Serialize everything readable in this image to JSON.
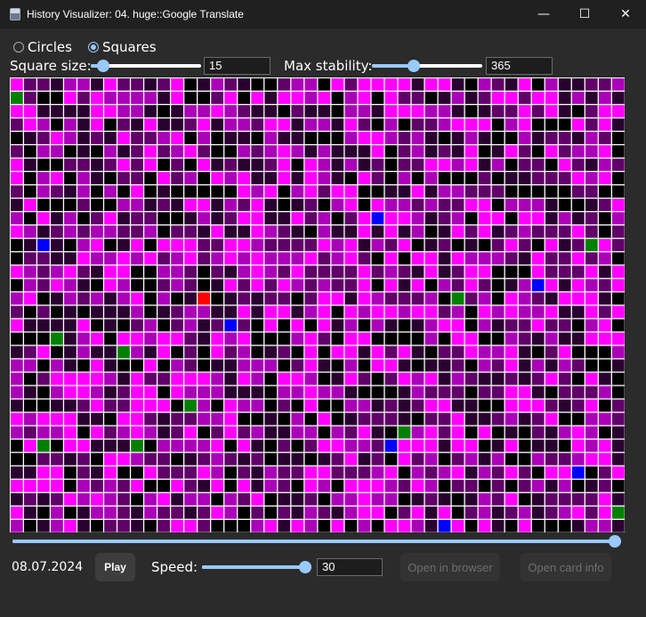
{
  "window": {
    "title": "History Visualizer: 04. huge::Google Translate",
    "minimize_glyph": "—",
    "maximize_glyph": "☐",
    "close_glyph": "✕"
  },
  "shape": {
    "options": [
      {
        "label": "Circles",
        "checked": false
      },
      {
        "label": "Squares",
        "checked": true
      }
    ]
  },
  "square_size": {
    "label": "Square size:",
    "value": "15",
    "fraction": 0.06
  },
  "max_stability": {
    "label": "Max stability:",
    "value": "365",
    "fraction": 0.36
  },
  "timeline": {
    "fraction": 1.0
  },
  "date": "08.07.2024",
  "play_label": "Play",
  "speed": {
    "label": "Speed:",
    "value": "30",
    "fraction": 1.0
  },
  "open_browser_label": "Open in browser",
  "open_card_label": "Open card info",
  "grid": {
    "cols": 46,
    "rows": 34,
    "palette": [
      "#000000",
      "#2a0030",
      "#600068",
      "#aa00b8",
      "#ff00ff"
    ],
    "special_colors": {
      "green": "#008000",
      "blue": "#0000ff",
      "red": "#ff0000"
    },
    "special_cells": [
      {
        "col": 0,
        "row": 1,
        "color": "green"
      },
      {
        "col": 27,
        "row": 10,
        "color": "blue"
      },
      {
        "col": 2,
        "row": 12,
        "color": "blue"
      },
      {
        "col": 43,
        "row": 12,
        "color": "green"
      },
      {
        "col": 39,
        "row": 15,
        "color": "blue"
      },
      {
        "col": 33,
        "row": 16,
        "color": "green"
      },
      {
        "col": 14,
        "row": 16,
        "color": "red"
      },
      {
        "col": 16,
        "row": 18,
        "color": "blue"
      },
      {
        "col": 3,
        "row": 19,
        "color": "green"
      },
      {
        "col": 8,
        "row": 20,
        "color": "green"
      },
      {
        "col": 13,
        "row": 24,
        "color": "green"
      },
      {
        "col": 29,
        "row": 26,
        "color": "green"
      },
      {
        "col": 2,
        "row": 27,
        "color": "green"
      },
      {
        "col": 9,
        "row": 27,
        "color": "green"
      },
      {
        "col": 28,
        "row": 27,
        "color": "blue"
      },
      {
        "col": 42,
        "row": 29,
        "color": "blue"
      },
      {
        "col": 45,
        "row": 32,
        "color": "green"
      },
      {
        "col": 32,
        "row": 33,
        "color": "blue"
      }
    ]
  },
  "colors": {
    "accent": "#99c9ff",
    "background": "#2b2b2b",
    "titlebar": "#202020"
  }
}
